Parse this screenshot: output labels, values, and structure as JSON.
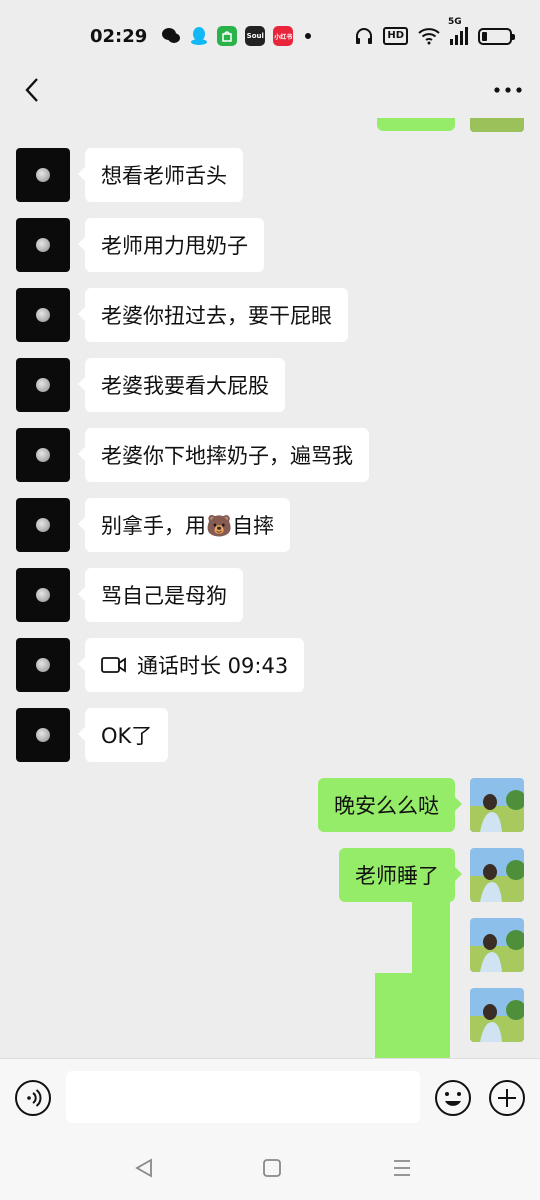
{
  "status_bar": {
    "time": "02:29",
    "apps": [
      {
        "name": "wechat-icon",
        "color": "#1aad19"
      },
      {
        "name": "qq-icon",
        "color": "#12b7f5"
      },
      {
        "name": "shopping-bag-icon",
        "color": "#2ab34a",
        "text": ""
      },
      {
        "name": "soul-icon",
        "color": "#222222",
        "text": "Soul"
      },
      {
        "name": "xiaohongshu-icon",
        "color": "#e8253d",
        "text": "小红书"
      }
    ],
    "hd": "HD",
    "network": "5G"
  },
  "nav": {
    "back_icon": "chevron-left-icon",
    "more_icon": "more-dots-icon"
  },
  "messages": [
    {
      "side": "left",
      "text": "想看老师舌头"
    },
    {
      "side": "left",
      "text": "老师用力甩奶子"
    },
    {
      "side": "left",
      "text": "老婆你扭过去，要干屁眼"
    },
    {
      "side": "left",
      "text": "老婆我要看大屁股"
    },
    {
      "side": "left",
      "text": "老婆你下地摔奶子，遍骂我"
    },
    {
      "side": "left",
      "text": "别拿手，用🐻自摔"
    },
    {
      "side": "left",
      "text": "骂自己是母狗"
    },
    {
      "side": "left",
      "type": "video-call",
      "text": "通话时长 09:43"
    },
    {
      "side": "left",
      "text": "OK了"
    },
    {
      "side": "right",
      "text": "晚安么么哒"
    },
    {
      "side": "right",
      "text": "老师睡了"
    }
  ],
  "colors": {
    "sent_bubble": "#95ec69",
    "received_bubble": "#ffffff",
    "background": "#ededed"
  },
  "input": {
    "value": "",
    "placeholder": ""
  }
}
